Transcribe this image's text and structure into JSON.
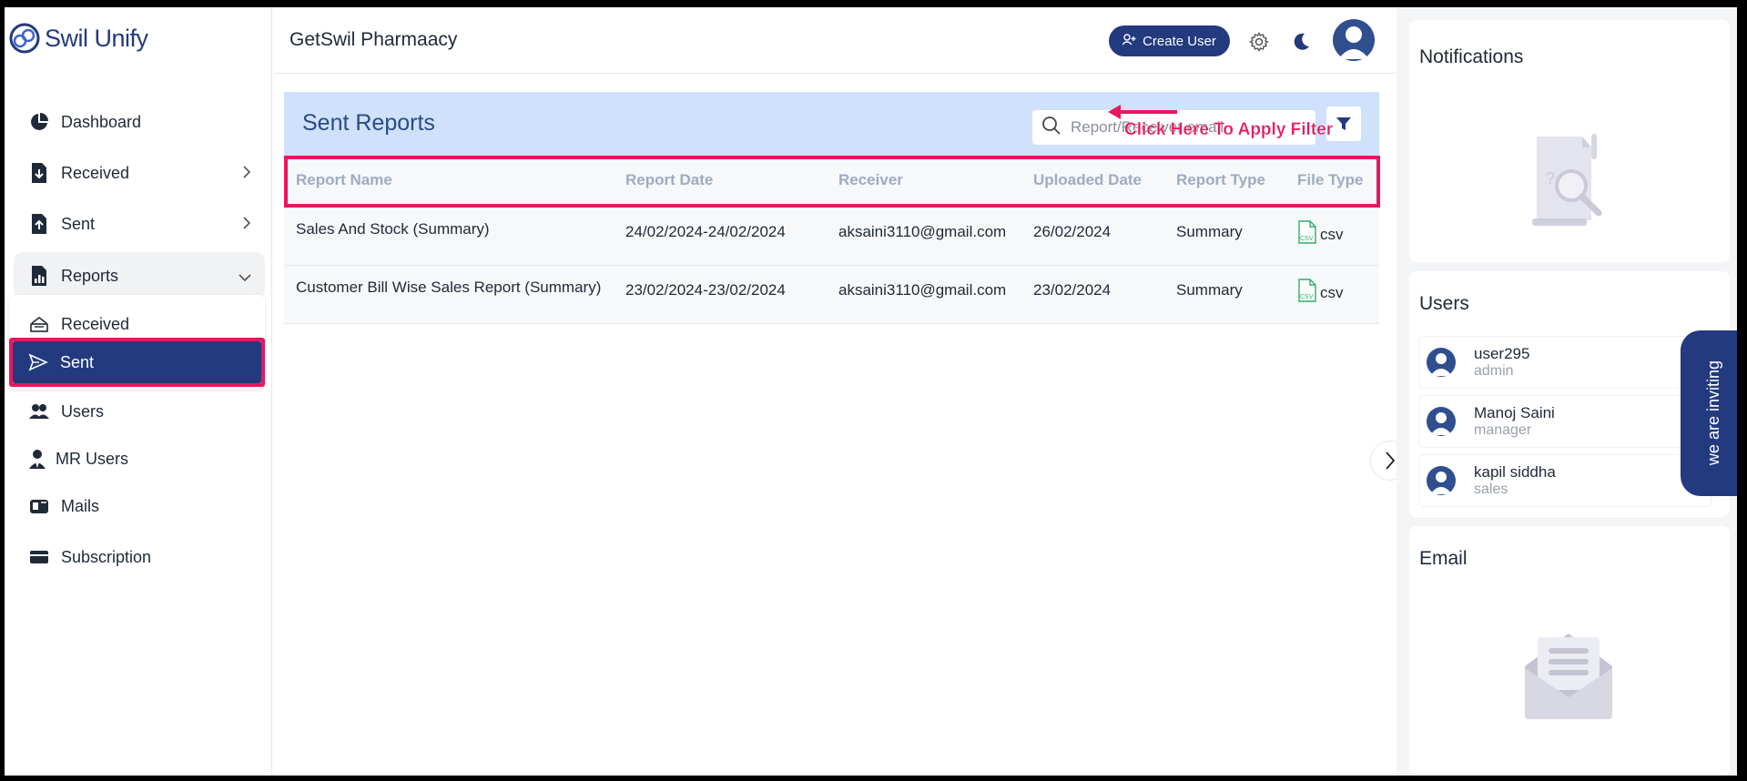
{
  "brand": {
    "name": "Swil Unify"
  },
  "sidebar": {
    "items": [
      {
        "label": "Dashboard"
      },
      {
        "label": "Received"
      },
      {
        "label": "Sent"
      },
      {
        "label": "Reports"
      },
      {
        "label": "Received"
      },
      {
        "label": "Sent"
      },
      {
        "label": "Users"
      },
      {
        "label": "MR Users"
      },
      {
        "label": "Mails"
      },
      {
        "label": "Subscription"
      }
    ]
  },
  "header": {
    "company": "GetSwil Pharmaacy",
    "create_user_label": "Create User"
  },
  "main": {
    "title": "Sent Reports",
    "search_placeholder": "Report/Receiver email",
    "annotation": "Click Here To Apply Filter",
    "columns": [
      "Report Name",
      "Report Date",
      "Receiver",
      "Uploaded Date",
      "Report Type",
      "File Type"
    ],
    "rows": [
      {
        "report_name": "Sales And Stock (Summary)",
        "report_date": "24/02/2024-24/02/2024",
        "receiver": "aksaini3110@gmail.com",
        "uploaded_date": "26/02/2024",
        "report_type": "Summary",
        "file_type": "csv"
      },
      {
        "report_name": "Customer Bill Wise Sales Report (Summary)",
        "report_date": "23/02/2024-23/02/2024",
        "receiver": "aksaini3110@gmail.com",
        "uploaded_date": "23/02/2024",
        "report_type": "Summary",
        "file_type": "csv"
      }
    ]
  },
  "right_panel": {
    "notifications_title": "Notifications",
    "users_title": "Users",
    "email_title": "Email",
    "users": [
      {
        "name": "user295",
        "role": "admin"
      },
      {
        "name": "Manoj Saini",
        "role": "manager"
      },
      {
        "name": "kapil siddha",
        "role": "sales"
      }
    ],
    "inviting_label": "we are inviting"
  },
  "colors": {
    "brand": "#233a7e",
    "panel_header": "#cfe1fb",
    "highlight": "#e8175d",
    "csv_green": "#2fae6b"
  }
}
